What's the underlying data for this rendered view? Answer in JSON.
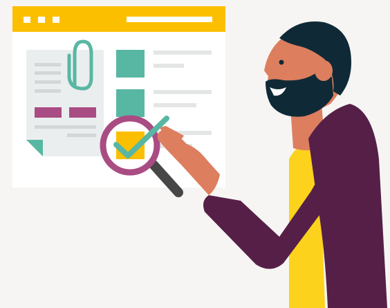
{
  "colors": {
    "background": "#f6f5f3",
    "window_bar": "#fcbf00",
    "window_body": "#ffffff",
    "document": "#ebeeee",
    "document_lines": "#d2d7d8",
    "document_fold": "#58b7a3",
    "accent_teal": "#58b7a3",
    "accent_purple": "#a94c83",
    "highlight_yellow": "#fcbf00",
    "list_lines": "#e4e6e6",
    "magnifier_handle": "#474747",
    "skin": "#dd7e5f",
    "hair": "#0f2a36",
    "shirt": "#fcd21d",
    "jacket": "#561f47"
  },
  "icons": [
    "browser-window-icon",
    "document-icon",
    "paperclip-icon",
    "magnifying-glass-icon",
    "checkmark-icon"
  ],
  "list_rows": [
    {
      "state": "plain"
    },
    {
      "state": "plain"
    },
    {
      "state": "checked"
    }
  ]
}
